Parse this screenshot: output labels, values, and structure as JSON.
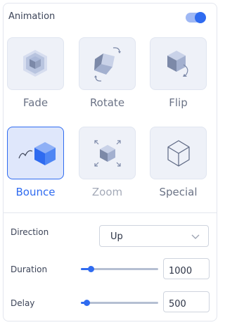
{
  "header": {
    "title": "Animation",
    "toggle_on": true
  },
  "tiles": [
    {
      "label": "Fade",
      "icon": "fade-cube-icon",
      "state": "normal"
    },
    {
      "label": "Rotate",
      "icon": "rotate-cube-icon",
      "state": "normal"
    },
    {
      "label": "Flip",
      "icon": "flip-cube-icon",
      "state": "normal"
    },
    {
      "label": "Bounce",
      "icon": "bounce-cube-icon",
      "state": "selected"
    },
    {
      "label": "Zoom",
      "icon": "zoom-cube-icon",
      "state": "disabled"
    },
    {
      "label": "Special",
      "icon": "outline-cube-icon",
      "state": "normal"
    }
  ],
  "direction": {
    "label": "Direction",
    "value": "Up",
    "icon": "chevron-down-icon"
  },
  "duration": {
    "label": "Duration",
    "value": "1000",
    "level": 0.13
  },
  "delay": {
    "label": "Delay",
    "value": "500",
    "level": 0.07
  },
  "colors": {
    "accent": "#2f6bf0",
    "tile_bg": "#eef1f8",
    "selected_bg": "#dfe7fb",
    "track": "#b5bfd2"
  }
}
